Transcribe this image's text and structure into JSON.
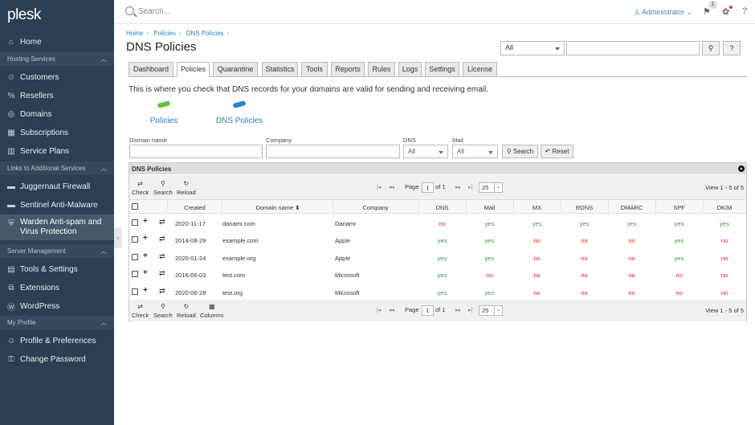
{
  "brand": "plesk",
  "sidebar": {
    "home": "Home",
    "sections": [
      {
        "label": "Hosting Services",
        "items": [
          "Customers",
          "Resellers",
          "Domains",
          "Subscriptions",
          "Service Plans"
        ]
      },
      {
        "label": "Links to Additional Services",
        "items": [
          "Juggernaut Firewall",
          "Sentinel Anti-Malware",
          "Warden Anti-spam and",
          "Virus Protection"
        ]
      },
      {
        "label": "Server Management",
        "items": [
          "Tools & Settings",
          "Extensions",
          "WordPress"
        ]
      },
      {
        "label": "My Profile",
        "items": [
          "Profile & Preferences",
          "Change Password"
        ]
      }
    ]
  },
  "topbar": {
    "search_placeholder": "Search...",
    "user": "Administrator",
    "notification_count": "1"
  },
  "breadcrumb": [
    "Home",
    "Policies",
    "DNS Policies"
  ],
  "page_title": "DNS Policies",
  "filter": {
    "select_value": "All"
  },
  "tabs": [
    "Dashboard",
    "Policies",
    "Quarantine",
    "Statistics",
    "Tools",
    "Reports",
    "Rules",
    "Logs",
    "Settings",
    "License"
  ],
  "active_tab": "Policies",
  "intro": "This is where you check that DNS records for your domains are valid for sending and receiving email.",
  "links": {
    "policies": "Policies",
    "dns_policies": "DNS Policies"
  },
  "colors": {
    "policies_icon": "#6ac13e",
    "dns_policies_icon": "#2f7fc9",
    "yes": "#3d9a3d",
    "no": "#d62020",
    "sidebar_bg": "#2a3f51"
  },
  "form": {
    "domain_name_label": "Domain name",
    "company_label": "Company",
    "dns_label": "DNS",
    "mail_label": "Mail",
    "dns_value": "All",
    "mail_value": "All",
    "search_button": "Search",
    "reset_button": "Reset"
  },
  "grid": {
    "title": "DNS Policies",
    "toolbar": {
      "check": "Check",
      "search": "Search",
      "reload": "Reload",
      "columns": "Columns"
    },
    "pager": {
      "page_label": "Page",
      "page": "1",
      "of_label": "of 1",
      "per_page": "25"
    },
    "view_text": "View 1 - 5 of 5",
    "columns": [
      "Created",
      "Domain name",
      "Company",
      "DNS",
      "Mail",
      "MX",
      "RDNS",
      "DMARC",
      "SPF",
      "DKIM"
    ],
    "rows": [
      {
        "created": "2020-11-17",
        "domain": "danami.com",
        "company": "Danami",
        "checks": [
          "no",
          "yes",
          "yes",
          "yes",
          "yes",
          "yes",
          "yes"
        ]
      },
      {
        "created": "2014-08-29",
        "domain": "example.com",
        "company": "Apple",
        "checks": [
          "yes",
          "yes",
          "no",
          "no",
          "no",
          "yes",
          "no"
        ]
      },
      {
        "created": "2020-01-24",
        "domain": "example.org",
        "company": "Apple",
        "checks": [
          "yes",
          "yes",
          "no",
          "no",
          "no",
          "yes",
          "no"
        ]
      },
      {
        "created": "2016-06-03",
        "domain": "test.com",
        "company": "Microsoft",
        "checks": [
          "yes",
          "no",
          "no",
          "no",
          "no",
          "no",
          "no"
        ]
      },
      {
        "created": "2020-06-28",
        "domain": "test.org",
        "company": "Microsoft",
        "checks": [
          "yes",
          "yes",
          "no",
          "no",
          "no",
          "no",
          "no"
        ]
      }
    ]
  }
}
